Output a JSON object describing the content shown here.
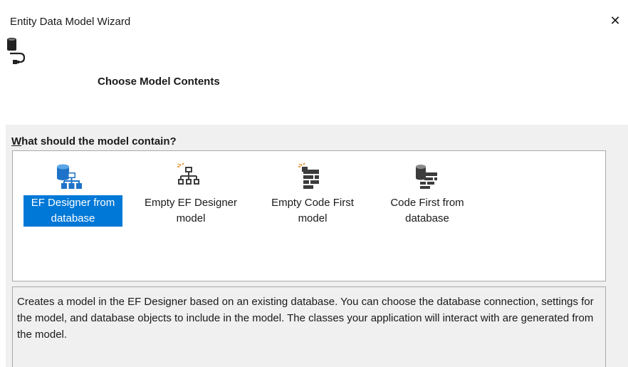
{
  "window": {
    "title": "Entity Data Model Wizard",
    "close_icon": "close-icon"
  },
  "header": {
    "step_title": "Choose Model Contents",
    "wizard_icon": "database-connection-icon"
  },
  "question": {
    "mnemonic": "W",
    "rest": "hat should the model contain?"
  },
  "options": [
    {
      "label": "EF Designer from\ndatabase",
      "icon": "database-diagram-icon",
      "selected": true
    },
    {
      "label": "Empty EF Designer\nmodel",
      "icon": "empty-diagram-icon",
      "selected": false
    },
    {
      "label": "Empty Code First\nmodel",
      "icon": "empty-code-first-icon",
      "selected": false
    },
    {
      "label": "Code First from\ndatabase",
      "icon": "code-first-database-icon",
      "selected": false
    }
  ],
  "description": "Creates a model in the EF Designer based on an existing database. You can choose the database connection, settings for the model, and database objects to include in the model. The classes your application will interact with are generated from the model.",
  "colors": {
    "selection": "#0078d7",
    "icon_blue": "#1e73c8",
    "icon_dark": "#3c3c3c",
    "spark_orange": "#e8871e"
  }
}
